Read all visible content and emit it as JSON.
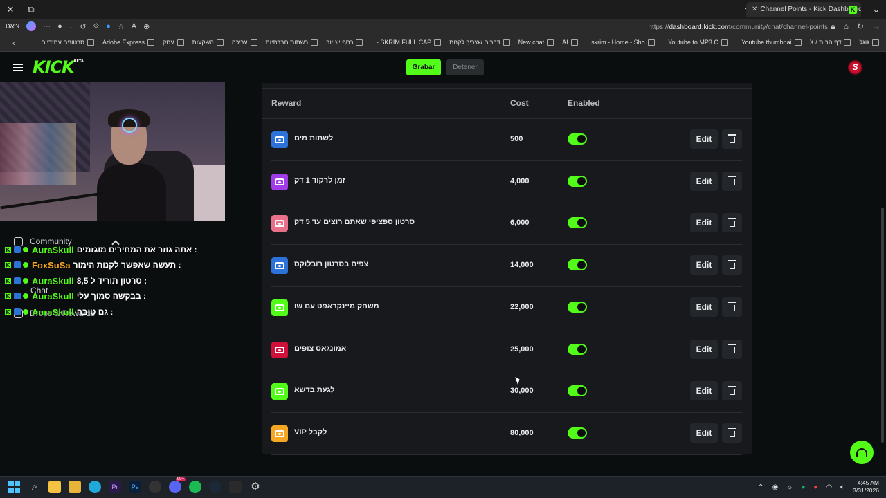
{
  "browser": {
    "tab_title": "Channel Points - Kick Dashboard",
    "tab_favicon": "K",
    "profile_label": "צ'אט",
    "url_prefix": "https://",
    "url_domain": "dashboard.kick.com",
    "url_path": "/community/chat/channel-points",
    "bookmarks": [
      "גוגל",
      "דף הבית / X",
      "Youtube thumbnai...",
      "Youtube to MP3 C...",
      "skrim - Home - Sho...",
      "AI",
      "New chat",
      "דברים שצריך לקנות",
      "SKRIM FULL CAP -...",
      "כסף יוטיוב",
      "רשתות חברתיות",
      "עריכה",
      "השקעות",
      "עסק",
      "Adobe Express",
      "סרטונים עתידיים"
    ]
  },
  "kick": {
    "logo": "KICK",
    "logo_badge": "BETA",
    "record_button": "Grabar",
    "stop_button": "Detener",
    "accent": "#53fc18"
  },
  "sidebar": {
    "community": "Community",
    "chat": "Chat",
    "drops": "Drops & Rewards"
  },
  "chat_messages": [
    {
      "user": "AuraSkull",
      "color": "#53fc18",
      "text": ": אתה גוזר את המחירים מוגזמים"
    },
    {
      "user": "FoxSuSa",
      "color": "#f5a623",
      "text": ": תעשה שאפשר לקנות הימור"
    },
    {
      "user": "AuraSkull",
      "color": "#53fc18",
      "text": ": סרטון תוריד ל 8,5"
    },
    {
      "user": "AuraSkull",
      "color": "#53fc18",
      "text": ": בבקשה סמוך עלי"
    },
    {
      "user": "AuraSkull",
      "color": "#53fc18",
      "text": ": גם טובה"
    }
  ],
  "table": {
    "headers": {
      "reward": "Reward",
      "cost": "Cost",
      "enabled": "Enabled"
    },
    "edit_label": "Edit",
    "rows": [
      {
        "name": "לשתות מים",
        "cost": "500",
        "color": "#2d72d9",
        "enabled": true
      },
      {
        "name": "זמן לרקוד 1 דק",
        "cost": "4,000",
        "color": "#a23be8",
        "enabled": true
      },
      {
        "name": "סרטון ספציפי שאתם רוצים עד 5 דק",
        "cost": "6,000",
        "color": "#e8708a",
        "enabled": true
      },
      {
        "name": "צפים בסרטון רובלוקס",
        "cost": "14,000",
        "color": "#2d72d9",
        "enabled": true
      },
      {
        "name": "משחק מיינקראפט עם שו",
        "cost": "22,000",
        "color": "#53fc18",
        "enabled": true
      },
      {
        "name": "אמונגאס צופים",
        "cost": "25,000",
        "color": "#d0103a",
        "enabled": true
      },
      {
        "name": "לגעת בדשא",
        "cost": "30,000",
        "color": "#53fc18",
        "enabled": true
      },
      {
        "name": "לקבל VIP",
        "cost": "80,000",
        "color": "#f5a623",
        "enabled": true
      }
    ]
  },
  "taskbar": {
    "time": "4:45 AM",
    "date": "3/31/2026",
    "notif_badge": "99+"
  }
}
